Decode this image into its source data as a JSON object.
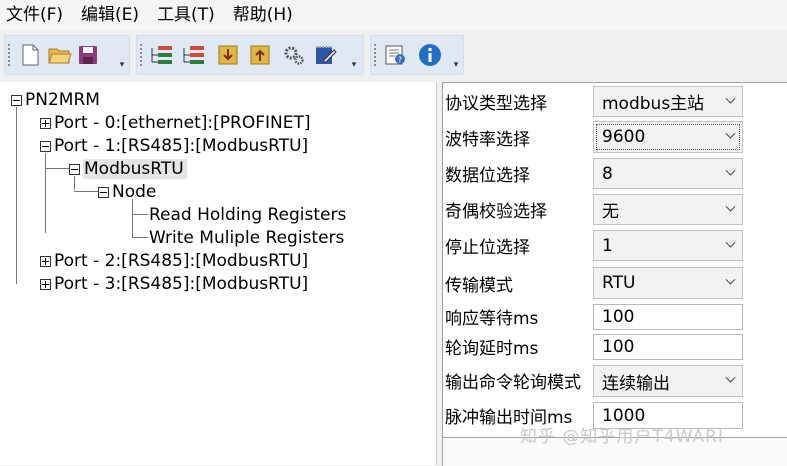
{
  "menu": [
    "文件(F)",
    "编辑(E)",
    "工具(T)",
    "帮助(H)"
  ],
  "toolbar": {
    "group1_icons": [
      "new-file-icon",
      "open-folder-icon",
      "save-icon"
    ],
    "group2_icons": [
      "add-node-icon",
      "remove-node-icon",
      "download-icon",
      "upload-icon",
      "settings-gears-icon",
      "edit-notebook-icon"
    ],
    "group3_icons": [
      "help-icon",
      "info-icon"
    ],
    "more_glyph": "▾"
  },
  "tree": {
    "root": "PN2MRM",
    "port0": "Port - 0:[ethernet]:[PROFINET]",
    "port1": "Port - 1:[RS485]:[ModbusRTU]",
    "modbus": "ModbusRTU",
    "node": "Node",
    "read": "Read Holding Registers",
    "write": "Write Muliple Registers",
    "port2": "Port - 2:[RS485]:[ModbusRTU]",
    "port3": "Port - 3:[RS485]:[ModbusRTU]"
  },
  "props": [
    {
      "label": "协议类型选择",
      "value": "modbus主站"
    },
    {
      "label": "波特率选择",
      "value": "9600"
    },
    {
      "label": "数据位选择",
      "value": "8"
    },
    {
      "label": "奇偶校验选择",
      "value": "无"
    },
    {
      "label": "停止位选择",
      "value": "1"
    },
    {
      "label": "传输模式",
      "value": "RTU"
    },
    {
      "label": "响应等待ms",
      "value": "100"
    },
    {
      "label": "轮询延时ms",
      "value": "100"
    },
    {
      "label": "输出命令轮询模式",
      "value": "连续输出"
    },
    {
      "label": "脉冲输出时间ms",
      "value": "1000"
    }
  ],
  "watermark": "知乎 @知乎用户T4WARI",
  "colors": {
    "toolbar_group": "#dfe8f3",
    "selection": "#e5e5e5",
    "info_blue": "#1f6fc5"
  }
}
